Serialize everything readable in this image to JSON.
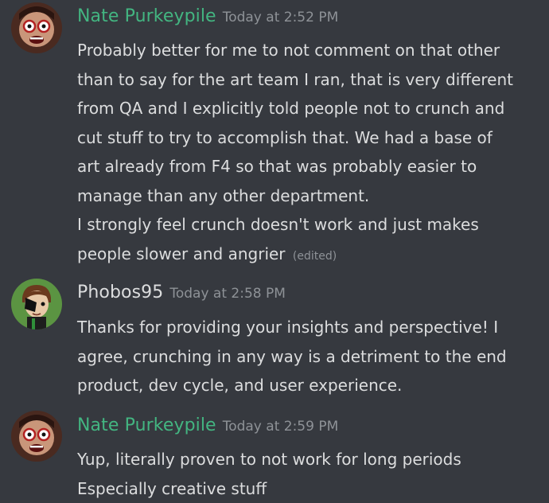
{
  "colors": {
    "background": "#36393f",
    "nate_name": "#43b581",
    "phobos_name": "#dcddde",
    "text": "#dcddde",
    "muted": "#8e9297"
  },
  "messages": [
    {
      "author": "Nate Purkeypile",
      "timestamp": "Today at 2:52 PM",
      "lines": [
        "Probably better for me to not comment on that other",
        "than to say for the art team I ran, that is very different",
        "from QA and I explicitly told people not to crunch and",
        "cut stuff to try to accomplish that. We had a base of",
        "art already from F4 so that was probably easier to",
        "manage than any other department.",
        "I strongly feel crunch doesn't work and just makes",
        "people slower and angrier"
      ],
      "edited": "(edited)"
    },
    {
      "author": "Phobos95",
      "timestamp": "Today at 2:58 PM",
      "lines": [
        "Thanks for providing your insights and perspective! I",
        "agree, crunching in any way is a detriment to the end",
        "product, dev cycle, and user experience."
      ]
    },
    {
      "author": "Nate Purkeypile",
      "timestamp": "Today at 2:59 PM",
      "lines": [
        "Yup, literally proven to not work for long periods",
        "Especially creative stuff"
      ]
    }
  ]
}
